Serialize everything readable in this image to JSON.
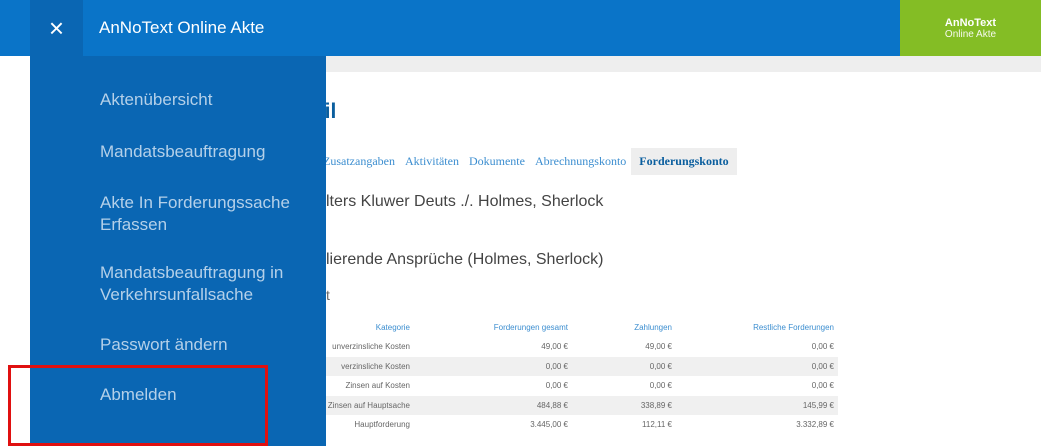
{
  "topbar": {
    "close_symbol": "×",
    "title": "AnNoText Online Akte",
    "brand_line1": "AnNoText",
    "brand_line2": "Online Akte",
    "color": "#0a74c8",
    "brand_color": "#84bd25"
  },
  "sidenav": {
    "color": "#0a66b3",
    "items": [
      {
        "label": "Aktenübersicht"
      },
      {
        "label": "Mandatsbeauftragung"
      },
      {
        "label_line1": "Akte In Forderungssache",
        "label_line2": "Erfassen"
      },
      {
        "label_line1": "Mandatsbeauftragung in",
        "label_line2": "Verkehrsunfallsache"
      },
      {
        "label": "Passwort ändern"
      },
      {
        "label": "Abmelden"
      }
    ]
  },
  "page": {
    "title": "ail",
    "tabs": [
      "Zusatzangaben",
      "Aktivitäten",
      "Dokumente",
      "Abrechnungskonto",
      "Forderungskonto"
    ],
    "active_tab": "Forderungskonto",
    "case_title": "lters Kluwer Deuts ./. Holmes, Sherlock",
    "claims_title": "lierende Ansprüche (Holmes, Sherlock)",
    "claims_sub": "t"
  },
  "table": {
    "headers": [
      "Kategorie",
      "Forderungen gesamt",
      "Zahlungen",
      "Restliche Forderungen"
    ],
    "rows": [
      [
        "unverzinsliche Kosten",
        "49,00 €",
        "49,00 €",
        "0,00 €"
      ],
      [
        "verzinsliche Kosten",
        "0,00 €",
        "0,00 €",
        "0,00 €"
      ],
      [
        "Zinsen auf Kosten",
        "0,00 €",
        "0,00 €",
        "0,00 €"
      ],
      [
        "Zinsen auf Hauptsache",
        "484,88 €",
        "338,89 €",
        "145,99 €"
      ],
      [
        "Hauptforderung",
        "3.445,00 €",
        "112,11 €",
        "3.332,89 €"
      ]
    ]
  },
  "highlight_color": "#e01010"
}
